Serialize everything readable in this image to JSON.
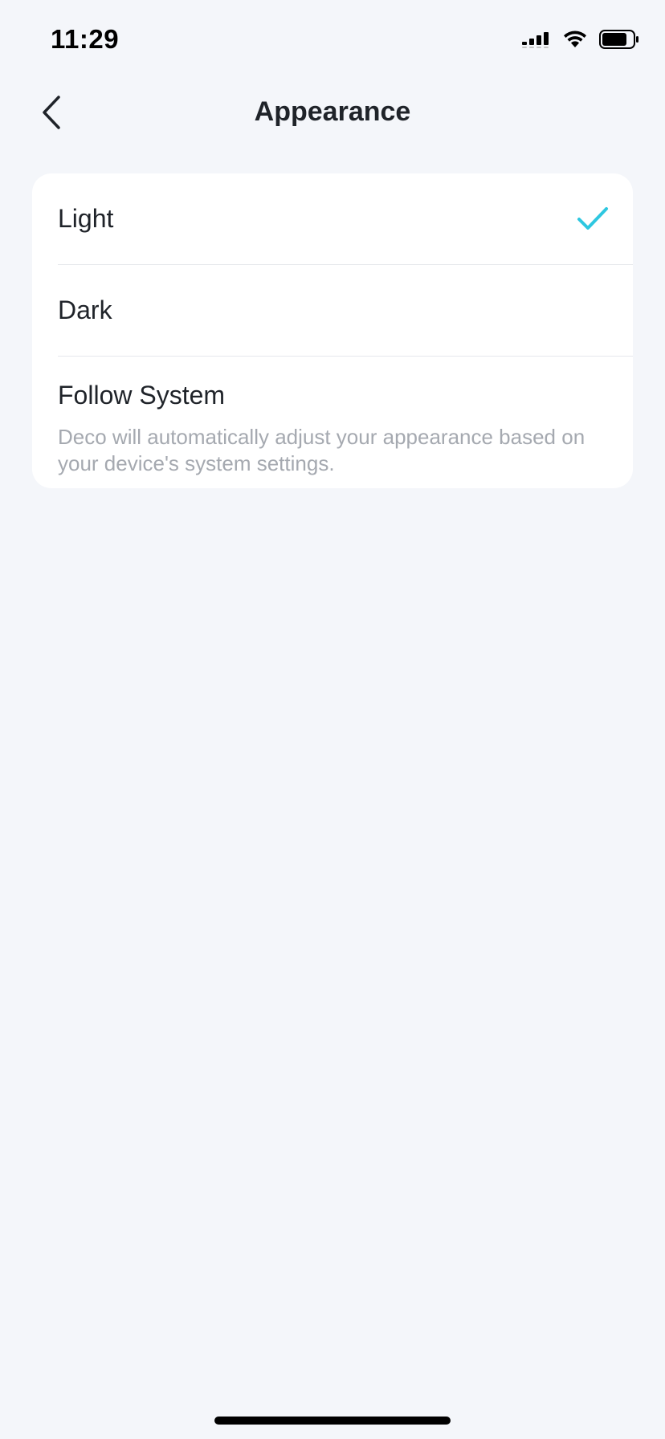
{
  "status_bar": {
    "time": "11:29",
    "icons": [
      "cellular-signal-icon",
      "wifi-icon",
      "battery-icon"
    ]
  },
  "nav": {
    "back_icon": "chevron-left-icon",
    "title": "Appearance"
  },
  "options": {
    "light": {
      "label": "Light",
      "selected": true
    },
    "dark": {
      "label": "Dark",
      "selected": false
    },
    "follow_system": {
      "label": "Follow System",
      "description": "Deco will automatically adjust your appearance based on your device's system settings.",
      "selected": false
    }
  },
  "colors": {
    "accent": "#2ec7e0",
    "background": "#f4f6fa",
    "card": "#ffffff",
    "text_primary": "#1f2329",
    "text_secondary": "#a5a9b0"
  }
}
